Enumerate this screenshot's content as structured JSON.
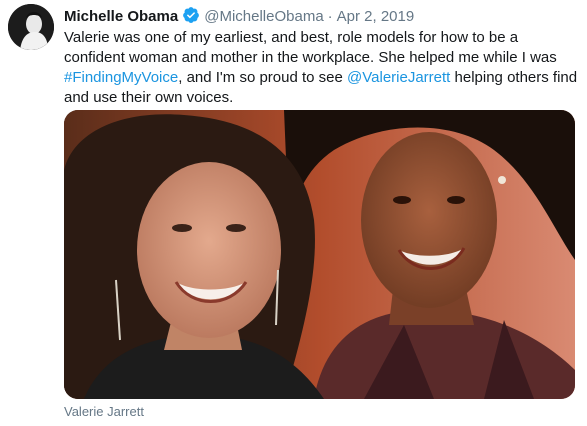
{
  "tweet": {
    "author_name": "Michelle Obama",
    "author_handle": "@MichelleObama",
    "separator": "·",
    "date": "Apr 2, 2019",
    "text_before_hashtag": "Valerie was one of my earliest, and best, role models for how to be a confident woman and mother in the workplace. She helped me while I was ",
    "hashtag": "#FindingMyVoice",
    "text_between": ", and I'm so proud to see ",
    "mention": "@ValerieJarrett",
    "text_after": " helping others find and use their own voices.",
    "photo_tag": "Valerie Jarrett",
    "verified_icon": "verified-badge-icon",
    "colors": {
      "link": "#1b95e0",
      "muted": "#657786",
      "verified": "#1da1f2"
    }
  }
}
